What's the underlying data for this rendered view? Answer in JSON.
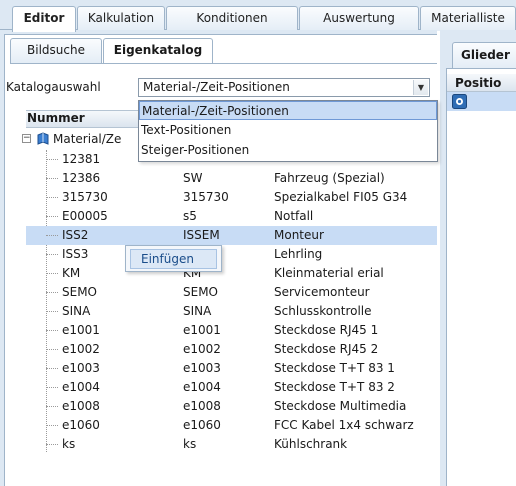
{
  "top_tabs": [
    "Editor",
    "Kalkulation",
    "Konditionen",
    "Auswertung",
    "Materialliste"
  ],
  "sub_tabs": [
    "Bildsuche",
    "Eigenkatalog"
  ],
  "katalog": {
    "label": "Katalogauswahl",
    "selected": "Material-/Zeit-Positionen",
    "options": [
      "Material-/Zeit-Positionen",
      "Text-Positionen",
      "Steiger-Positionen"
    ]
  },
  "grid": {
    "header_nummer": "Nummer",
    "root_label": "Material/Ze",
    "rows": [
      {
        "c1": "12381",
        "c2": "",
        "c3": ""
      },
      {
        "c1": "12386",
        "c2": "SW",
        "c3": "Fahrzeug (Spezial)"
      },
      {
        "c1": "315730",
        "c2": "315730",
        "c3": "Spezialkabel FI05 G34"
      },
      {
        "c1": "E00005",
        "c2": "s5",
        "c3": "Notfall"
      },
      {
        "c1": "ISS2",
        "c2": "ISSEM",
        "c3": "Monteur"
      },
      {
        "c1": "ISS3",
        "c2": "",
        "c3": "Lehrling"
      },
      {
        "c1": "KM",
        "c2": "KM",
        "c3": "Kleinmaterial erial"
      },
      {
        "c1": "SEMO",
        "c2": "SEMO",
        "c3": "Servicemonteur"
      },
      {
        "c1": "SINA",
        "c2": "SINA",
        "c3": "Schlusskontrolle"
      },
      {
        "c1": "e1001",
        "c2": "e1001",
        "c3": "Steckdose RJ45 1"
      },
      {
        "c1": "e1002",
        "c2": "e1002",
        "c3": "Steckdose RJ45 2"
      },
      {
        "c1": "e1003",
        "c2": "e1003",
        "c3": "Steckdose T+T 83 1"
      },
      {
        "c1": "e1004",
        "c2": "e1004",
        "c3": "Steckdose T+T 83 2"
      },
      {
        "c1": "e1008",
        "c2": "e1008",
        "c3": "Steckdose Multimedia"
      },
      {
        "c1": "e1060",
        "c2": "e1060",
        "c3": "FCC Kabel 1x4 schwarz"
      },
      {
        "c1": "ks",
        "c2": "ks",
        "c3": "Kühlschrank"
      }
    ]
  },
  "context_menu": {
    "item": "Einfügen"
  },
  "right_panel": {
    "tab": "Glieder",
    "header": "Positio"
  },
  "colors": {
    "selection": "#c8dcf5",
    "panel_bg": "#dde8f3",
    "border": "#9fb4c9"
  }
}
